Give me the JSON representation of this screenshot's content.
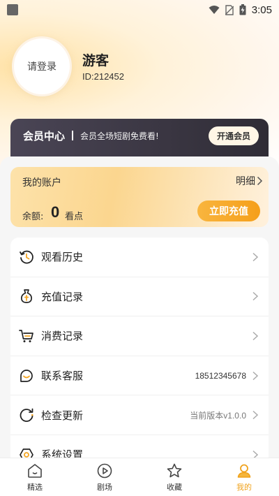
{
  "status_bar": {
    "time": "3:05"
  },
  "profile": {
    "avatar_text": "请登录",
    "username": "游客",
    "user_id": "ID:212452"
  },
  "vip": {
    "title": "会员中心",
    "description": "会员全场短剧免费看!",
    "button": "开通会员"
  },
  "account": {
    "title": "我的账户",
    "detail": "明细",
    "balance_label": "余额:",
    "balance_value": "0",
    "balance_unit": "看点",
    "topup_button": "立即充值"
  },
  "menu": {
    "items": [
      {
        "label": "观看历史",
        "icon": "history-icon"
      },
      {
        "label": "充值记录",
        "icon": "money-bag-icon"
      },
      {
        "label": "消费记录",
        "icon": "cart-icon"
      },
      {
        "label": "联系客服",
        "icon": "customer-service-icon",
        "value": "18512345678"
      },
      {
        "label": "检查更新",
        "icon": "refresh-icon",
        "value": "当前版本v1.0.0"
      },
      {
        "label": "系统设置",
        "icon": "settings-icon"
      }
    ]
  },
  "tabs": [
    {
      "label": "精选",
      "icon": "home-icon",
      "active": false
    },
    {
      "label": "剧场",
      "icon": "play-circle-icon",
      "active": false
    },
    {
      "label": "收藏",
      "icon": "star-icon",
      "active": false
    },
    {
      "label": "我的",
      "icon": "user-icon",
      "active": true
    }
  ],
  "colors": {
    "accent": "#f5a623",
    "vip_bar": "#3a3642",
    "account_card": "#fbd68f"
  }
}
